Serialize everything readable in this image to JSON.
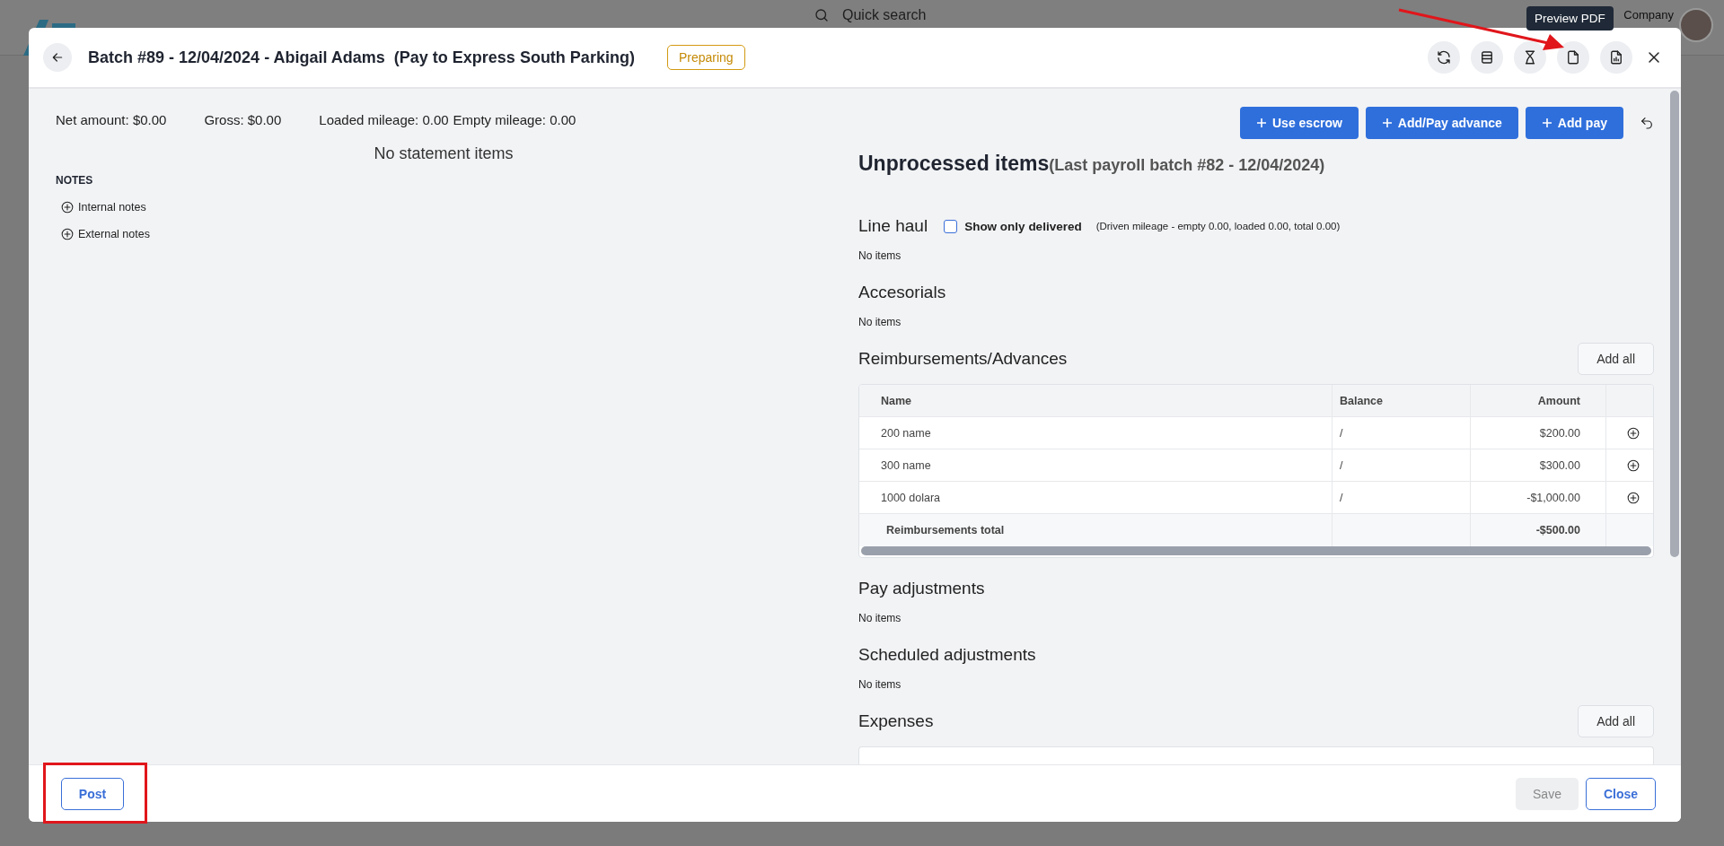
{
  "app": {
    "search": "Quick search",
    "company": "Company"
  },
  "dialog": {
    "title": "Batch #89 - 12/04/2024 - Abigail Adams  (Pay to Express South Parking)",
    "status": "Preparing",
    "tooltip": "Preview PDF"
  },
  "summary": [
    "Net amount: $0.00",
    "Gross: $0.00",
    "Loaded mileage: 0.00",
    "Empty mileage: 0.00"
  ],
  "statement": {
    "empty_text": "No statement items"
  },
  "notes": {
    "heading": "NOTES",
    "items": [
      "Internal notes",
      "External notes"
    ]
  },
  "actions": [
    "Use escrow",
    "Add/Pay advance",
    "Add pay"
  ],
  "unprocessed": {
    "title": "Unprocessed items",
    "subtitle": "(Last payroll batch #82 - 12/04/2024)"
  },
  "sections": [
    {
      "kind": "filter",
      "title": "Line haul",
      "filter": {
        "label": "Show only delivered",
        "checked": false
      },
      "note": "(Driven mileage - empty 0.00, loaded 0.00, total 0.00)",
      "empty": "No items"
    },
    {
      "kind": "empty",
      "title": "Accesorials",
      "empty": "No items"
    },
    {
      "kind": "table",
      "title": "Reimbursements/Advances",
      "button": "Add all",
      "columns": [
        "Name",
        "Balance",
        "Amount"
      ],
      "rows": [
        {
          "name": "200 name",
          "balance": "/",
          "amount": "$200.00"
        },
        {
          "name": "300 name",
          "balance": "/",
          "amount": "$300.00"
        },
        {
          "name": "1000 dolara",
          "balance": "/",
          "amount": "-$1,000.00"
        }
      ],
      "total": {
        "label": "Reimbursements total",
        "amount": "-$500.00"
      }
    },
    {
      "kind": "empty",
      "title": "Pay adjustments",
      "empty": "No items"
    },
    {
      "kind": "empty",
      "title": "Scheduled adjustments",
      "empty": "No items"
    },
    {
      "kind": "cut",
      "title": "Expenses",
      "button": "Add all"
    }
  ],
  "footer": {
    "post": "Post",
    "save": {
      "label": "Save",
      "disabled": true
    },
    "close": "Close"
  }
}
